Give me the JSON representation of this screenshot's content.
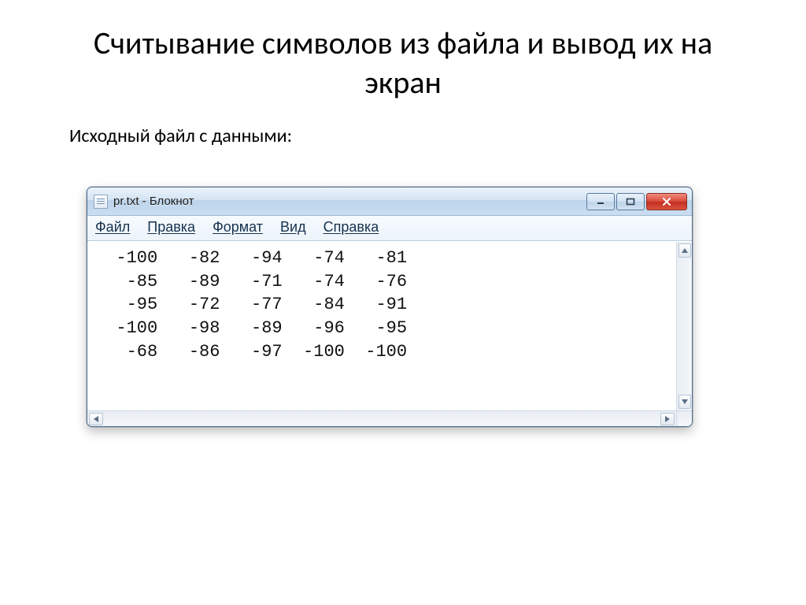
{
  "slide": {
    "title": "Считывание символов из файла и вывод их на экран",
    "subtitle": "Исходный файл с данными:"
  },
  "window": {
    "title": "pr.txt - Блокнот",
    "menu": {
      "file": "Файл",
      "edit": "Правка",
      "format": "Формат",
      "view": "Вид",
      "help": "Справка"
    },
    "data_rows": [
      [
        -100,
        -82,
        -94,
        -74,
        -81
      ],
      [
        -85,
        -89,
        -71,
        -74,
        -76
      ],
      [
        -95,
        -72,
        -77,
        -84,
        -91
      ],
      [
        -100,
        -98,
        -89,
        -96,
        -95
      ],
      [
        -68,
        -86,
        -97,
        -100,
        -100
      ]
    ]
  }
}
